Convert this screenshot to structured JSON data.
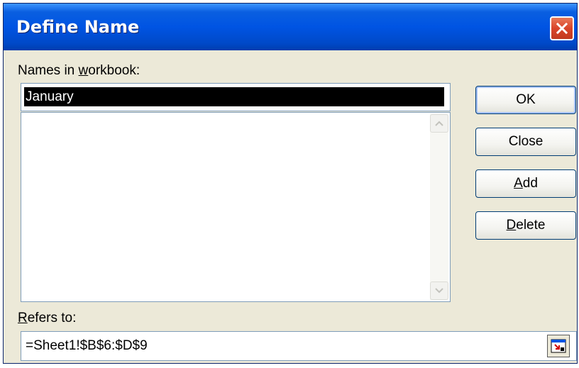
{
  "window": {
    "title": "Define Name"
  },
  "names": {
    "label": "Names in workbook:",
    "label_pre": "Names in ",
    "label_u": "w",
    "label_post": "orkbook:",
    "current_value": "January",
    "list_items": []
  },
  "buttons": {
    "ok": "OK",
    "close": "Close",
    "add_u": "A",
    "add_rest": "dd",
    "delete_u": "D",
    "delete_rest": "elete"
  },
  "refers": {
    "label_u": "R",
    "label_rest": "efers to:",
    "value": "=Sheet1!$B$6:$D$9"
  },
  "icons": {
    "close": "close-x-icon",
    "scroll_up": "arrow-up-icon",
    "scroll_down": "arrow-down-icon",
    "collapse": "collapse-dialog-icon"
  },
  "colors": {
    "titlebar": "#0054e3",
    "dialog_bg": "#ece9d8",
    "close_button": "#d9442a",
    "selection": "#000000"
  }
}
